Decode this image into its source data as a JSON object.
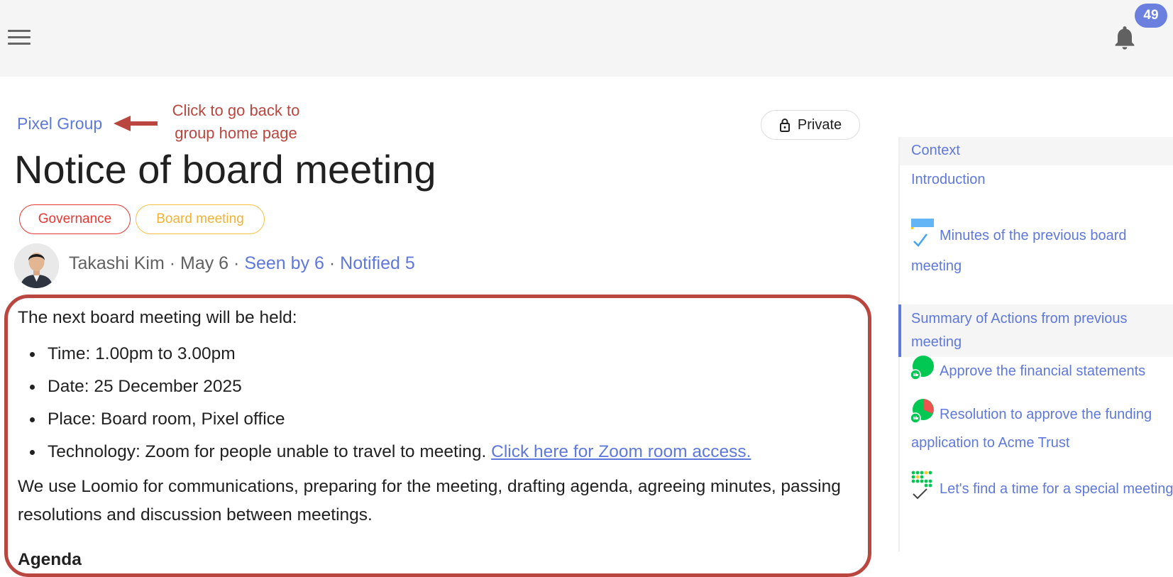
{
  "topbar": {
    "menu_icon": "hamburger-menu-icon",
    "bell_icon": "bell-icon",
    "notification_count": "49",
    "accent_color": "#6b7fde"
  },
  "breadcrumb": {
    "group_link": "Pixel Group"
  },
  "annotation": {
    "text_line1": "Click to go back to",
    "text_line2": "group home page",
    "color": "#b9473f"
  },
  "privacy": {
    "label": "Private",
    "icon": "lock-icon"
  },
  "thread": {
    "title": "Notice of board meeting",
    "tags": [
      {
        "label": "Governance",
        "color": "#e53935"
      },
      {
        "label": "Board meeting",
        "color": "#f2b233"
      }
    ],
    "author": "Takashi Kim",
    "date": "May 6",
    "separator": "·",
    "seen": "Seen by 6",
    "notified": "Notified 5"
  },
  "body": {
    "intro": "The next board meeting will be held:",
    "items": [
      "Time: 1.00pm to 3.00pm",
      "Date: 25 December 2025",
      "Place: Board room, Pixel office",
      "Technology: Zoom for people unable to travel to meeting."
    ],
    "zoom_link": "Click here for Zoom room access.",
    "paragraph": "We use Loomio for communications, preparing for the meeting, drafting agenda, agreeing minutes, passing resolutions and discussion between meetings.",
    "agenda_heading": "Agenda"
  },
  "sidebar": {
    "context": "Context",
    "introduction": "Introduction",
    "minutes": "Minutes of the previous board meeting",
    "summary": "Summary of Actions from previous meeting",
    "approve": "Approve the financial statements",
    "resolution": "Resolution to approve the funding application to Acme Trust",
    "special": "Let's find a time for a special meeting"
  }
}
